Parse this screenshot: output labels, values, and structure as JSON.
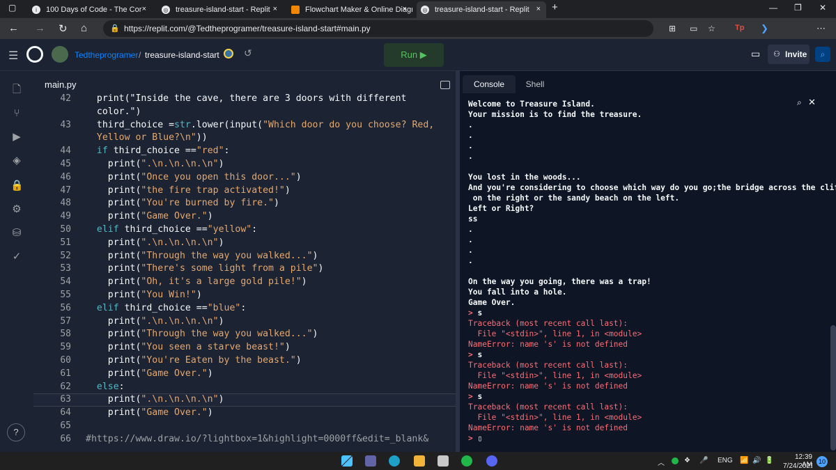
{
  "browser": {
    "tabs": [
      {
        "label": "100 Days of Code - The Cor",
        "icon": "youtube-icon"
      },
      {
        "label": "treasure-island-start - Replit",
        "icon": "replit-icon"
      },
      {
        "label": "Flowchart Maker & Online Diagr",
        "icon": "drawio-icon"
      },
      {
        "label": "treasure-island-start - Replit",
        "icon": "replit-icon"
      }
    ],
    "url": "https://replit.com/@Tedtheprogramer/treasure-island-start#main.py"
  },
  "replit": {
    "user": "Tedtheprogramer",
    "separator": "/",
    "project": "treasure-island-start",
    "run_label": "Run ▶",
    "invite_label": "Invite"
  },
  "editor": {
    "filename": "main.py",
    "lines": [
      {
        "n": "42",
        "code": [
          {
            "t": "  print(\"Inside the cave, there are 3 doors with different",
            "c": "p"
          }
        ]
      },
      {
        "n": "",
        "code": [
          {
            "t": "  color.\")",
            "c": "p"
          }
        ]
      },
      {
        "n": "43",
        "code": [
          {
            "t": "  third_choice =",
            "c": "p"
          },
          {
            "t": "str",
            "c": "k"
          },
          {
            "t": ".lower(input(",
            "c": "p"
          },
          {
            "t": "\"Which door do you choose? Red,",
            "c": "s"
          }
        ]
      },
      {
        "n": "",
        "code": [
          {
            "t": "  Yellow or Blue?\\n\"",
            "c": "s"
          },
          {
            "t": "))",
            "c": "p"
          }
        ]
      },
      {
        "n": "44",
        "code": [
          {
            "t": "  if",
            "c": "k"
          },
          {
            "t": " third_choice ==",
            "c": "p"
          },
          {
            "t": "\"red\"",
            "c": "s"
          },
          {
            "t": ":",
            "c": "p"
          }
        ]
      },
      {
        "n": "45",
        "code": [
          {
            "t": "    print(",
            "c": "p"
          },
          {
            "t": "\".\\n.\\n.\\n.\\n\"",
            "c": "s"
          },
          {
            "t": ")",
            "c": "p"
          }
        ]
      },
      {
        "n": "46",
        "code": [
          {
            "t": "    print(",
            "c": "p"
          },
          {
            "t": "\"Once you open this door...\"",
            "c": "s"
          },
          {
            "t": ")",
            "c": "p"
          }
        ]
      },
      {
        "n": "47",
        "code": [
          {
            "t": "    print(",
            "c": "p"
          },
          {
            "t": "\"the fire trap activated!\"",
            "c": "s"
          },
          {
            "t": ")",
            "c": "p"
          }
        ]
      },
      {
        "n": "48",
        "code": [
          {
            "t": "    print(",
            "c": "p"
          },
          {
            "t": "\"You're burned by fire.\"",
            "c": "s"
          },
          {
            "t": ")",
            "c": "p"
          }
        ]
      },
      {
        "n": "49",
        "code": [
          {
            "t": "    print(",
            "c": "p"
          },
          {
            "t": "\"Game Over.\"",
            "c": "s"
          },
          {
            "t": ")",
            "c": "p"
          }
        ]
      },
      {
        "n": "50",
        "code": [
          {
            "t": "  elif",
            "c": "k"
          },
          {
            "t": " third_choice ==",
            "c": "p"
          },
          {
            "t": "\"yellow\"",
            "c": "s"
          },
          {
            "t": ":",
            "c": "p"
          }
        ]
      },
      {
        "n": "51",
        "code": [
          {
            "t": "    print(",
            "c": "p"
          },
          {
            "t": "\".\\n.\\n.\\n.\\n\"",
            "c": "s"
          },
          {
            "t": ")",
            "c": "p"
          }
        ]
      },
      {
        "n": "52",
        "code": [
          {
            "t": "    print(",
            "c": "p"
          },
          {
            "t": "\"Through the way you walked...\"",
            "c": "s"
          },
          {
            "t": ")",
            "c": "p"
          }
        ]
      },
      {
        "n": "53",
        "code": [
          {
            "t": "    print(",
            "c": "p"
          },
          {
            "t": "\"There's some light from a pile\"",
            "c": "s"
          },
          {
            "t": ")",
            "c": "p"
          }
        ]
      },
      {
        "n": "54",
        "code": [
          {
            "t": "    print(",
            "c": "p"
          },
          {
            "t": "\"Oh, it's a large gold pile!\"",
            "c": "s"
          },
          {
            "t": ")",
            "c": "p"
          }
        ]
      },
      {
        "n": "55",
        "code": [
          {
            "t": "    print(",
            "c": "p"
          },
          {
            "t": "\"You Win!\"",
            "c": "s"
          },
          {
            "t": ")",
            "c": "p"
          }
        ]
      },
      {
        "n": "56",
        "code": [
          {
            "t": "  elif",
            "c": "k"
          },
          {
            "t": " third_choice ==",
            "c": "p"
          },
          {
            "t": "\"blue\"",
            "c": "s"
          },
          {
            "t": ":",
            "c": "p"
          }
        ]
      },
      {
        "n": "57",
        "code": [
          {
            "t": "    print(",
            "c": "p"
          },
          {
            "t": "\".\\n.\\n.\\n.\\n\"",
            "c": "s"
          },
          {
            "t": ")",
            "c": "p"
          }
        ]
      },
      {
        "n": "58",
        "code": [
          {
            "t": "    print(",
            "c": "p"
          },
          {
            "t": "\"Through the way you walked...\"",
            "c": "s"
          },
          {
            "t": ")",
            "c": "p"
          }
        ]
      },
      {
        "n": "59",
        "code": [
          {
            "t": "    print(",
            "c": "p"
          },
          {
            "t": "\"You seen a starve beast!\"",
            "c": "s"
          },
          {
            "t": ")",
            "c": "p"
          }
        ]
      },
      {
        "n": "60",
        "code": [
          {
            "t": "    print(",
            "c": "p"
          },
          {
            "t": "\"You're Eaten by the beast.\"",
            "c": "s"
          },
          {
            "t": ")",
            "c": "p"
          }
        ]
      },
      {
        "n": "61",
        "code": [
          {
            "t": "    print(",
            "c": "p"
          },
          {
            "t": "\"Game Over.\"",
            "c": "s"
          },
          {
            "t": ")",
            "c": "p"
          }
        ]
      },
      {
        "n": "62",
        "code": [
          {
            "t": "  else",
            "c": "k"
          },
          {
            "t": ":",
            "c": "p"
          }
        ]
      },
      {
        "n": "63",
        "code": [
          {
            "t": "    print(",
            "c": "p"
          },
          {
            "t": "\".\\n.\\n.\\n.\\n\"",
            "c": "s"
          },
          {
            "t": ")",
            "c": "p"
          }
        ]
      },
      {
        "n": "64",
        "code": [
          {
            "t": "    print(",
            "c": "p"
          },
          {
            "t": "\"Game Over.\"",
            "c": "s"
          },
          {
            "t": ")",
            "c": "p"
          }
        ]
      },
      {
        "n": "65",
        "code": []
      },
      {
        "n": "66",
        "code": [
          {
            "t": "#https://www.draw.io/?lightbox=1&highlight=0000ff&edit=_blank&",
            "c": "c"
          }
        ]
      }
    ]
  },
  "console": {
    "tabs": [
      "Console",
      "Shell"
    ],
    "lines": [
      {
        "t": "Welcome to Treasure Island.",
        "c": "o"
      },
      {
        "t": "Your mission is to find the treasure.",
        "c": "o"
      },
      {
        "t": ".",
        "c": "o"
      },
      {
        "t": ".",
        "c": "o"
      },
      {
        "t": ".",
        "c": "o"
      },
      {
        "t": ".",
        "c": "o"
      },
      {
        "t": "",
        "c": "o"
      },
      {
        "t": "You lost in the woods...",
        "c": "o"
      },
      {
        "t": "And you're considering to choose which way do you go;the bridge across the cliffs",
        "c": "o"
      },
      {
        "t": " on the right or the sandy beach on the left.",
        "c": "o"
      },
      {
        "t": "Left or Right?",
        "c": "o"
      },
      {
        "t": "ss",
        "c": "o"
      },
      {
        "t": ".",
        "c": "o"
      },
      {
        "t": ".",
        "c": "o"
      },
      {
        "t": ".",
        "c": "o"
      },
      {
        "t": ".",
        "c": "o"
      },
      {
        "t": "",
        "c": "o"
      },
      {
        "t": "On the way you going, there was a trap!",
        "c": "o"
      },
      {
        "t": "You fall into a hole.",
        "c": "o"
      },
      {
        "t": "Game Over.",
        "c": "o"
      },
      {
        "t": "> s",
        "c": "p"
      },
      {
        "t": "Traceback (most recent call last):",
        "c": "e"
      },
      {
        "t": "  File \"<stdin>\", line 1, in <module>",
        "c": "e"
      },
      {
        "t": "NameError: name 's' is not defined",
        "c": "e"
      },
      {
        "t": "> s",
        "c": "p"
      },
      {
        "t": "Traceback (most recent call last):",
        "c": "e"
      },
      {
        "t": "  File \"<stdin>\", line 1, in <module>",
        "c": "e"
      },
      {
        "t": "NameError: name 's' is not defined",
        "c": "e"
      },
      {
        "t": "> s",
        "c": "p"
      },
      {
        "t": "Traceback (most recent call last):",
        "c": "e"
      },
      {
        "t": "  File \"<stdin>\", line 1, in <module>",
        "c": "e"
      },
      {
        "t": "NameError: name 's' is not defined",
        "c": "e"
      },
      {
        "t": "> ▯",
        "c": "p"
      }
    ]
  },
  "taskbar": {
    "lang": "ENG",
    "time": "12:39 AM",
    "date": "7/24/2021",
    "notifications": "10"
  },
  "colors": {
    "accent": "#0079f2",
    "run_green": "#53c45e",
    "error_red": "#fd6c75",
    "string_orange": "#e5a86d",
    "keyword_cyan": "#56b6c2"
  }
}
